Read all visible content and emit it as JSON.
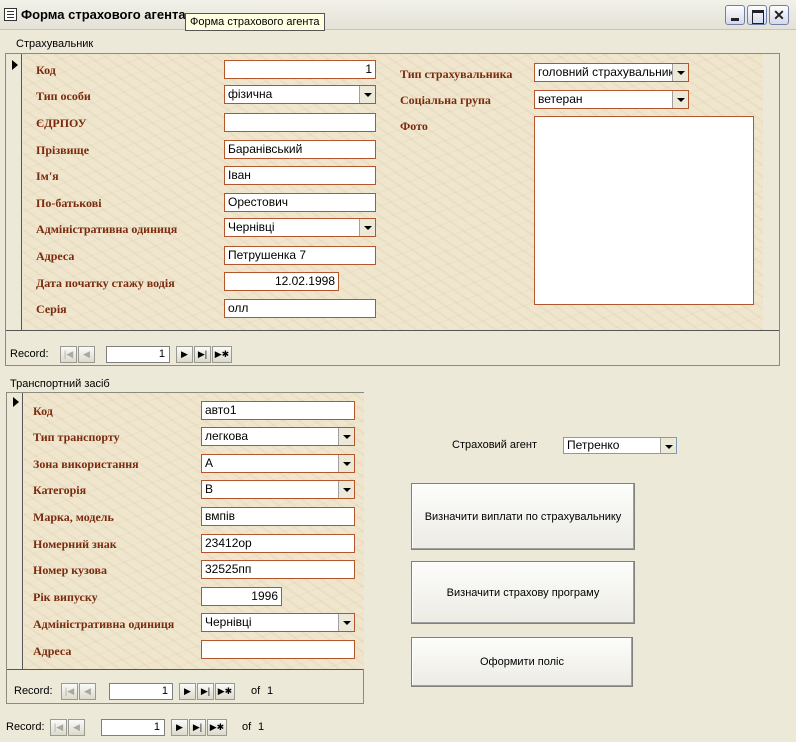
{
  "window": {
    "title": "Форма страхового агента",
    "tooltip": "Форма страхового агента",
    "minimize_icon": "minimize-icon",
    "maximize_icon": "maximize-icon",
    "close_icon": "close-icon",
    "close_glyph": "✕"
  },
  "insured": {
    "section_label": "Страхувальник",
    "fields": {
      "code": {
        "label": "Код",
        "value": "1"
      },
      "person_type": {
        "label": "Тип особи",
        "value": "фізична"
      },
      "edrpou": {
        "label": "ЄДРПОУ",
        "value": ""
      },
      "surname": {
        "label": "Прізвище",
        "value": "Баранівський"
      },
      "name": {
        "label": "Ім'я",
        "value": "Іван"
      },
      "patronymic": {
        "label": "По-батькові",
        "value": "Орестович"
      },
      "admin_unit": {
        "label": "Адміністративна одиниця",
        "value": "Чернівці"
      },
      "address": {
        "label": "Адреса",
        "value": "Петрушенка 7"
      },
      "driving_start": {
        "label": "Дата початку стажу водія",
        "value": "12.02.1998"
      },
      "series": {
        "label": "Серія",
        "value": "олл"
      },
      "insured_type": {
        "label": "Тип страхувальника",
        "value": "головний страхувальник"
      },
      "social_group": {
        "label": "Соціальна група",
        "value": "ветеран"
      },
      "photo": {
        "label": "Фото"
      }
    },
    "nav": {
      "label": "Record:",
      "current": "1",
      "of_text": "",
      "total": ""
    }
  },
  "vehicle": {
    "section_label": "Транспортний засіб",
    "fields": {
      "code": {
        "label": "Код",
        "value": "авто1"
      },
      "transport_type": {
        "label": "Тип транспорту",
        "value": "легкова"
      },
      "usage_zone": {
        "label": "Зона використання",
        "value": "А"
      },
      "category": {
        "label": "Категорія",
        "value": "В"
      },
      "make_model": {
        "label": "Марка, модель",
        "value": "вмпів"
      },
      "plate": {
        "label": "Номерний знак",
        "value": "23412ор"
      },
      "body_number": {
        "label": "Номер кузова",
        "value": "32525пп"
      },
      "year": {
        "label": "Рік випуску",
        "value": "1996"
      },
      "admin_unit": {
        "label": "Адміністративна одиниця",
        "value": "Чернівці"
      },
      "address": {
        "label": "Адреса",
        "value": ""
      }
    },
    "nav": {
      "label": "Record:",
      "current": "1",
      "of_text": "of",
      "total": "1"
    }
  },
  "agent": {
    "label": "Страховий агент",
    "value": "Петренко"
  },
  "buttons": {
    "payouts": "Визначити виплати по страхувальнику",
    "program": "Визначити страхову програму",
    "policy": "Оформити поліс"
  },
  "main_nav": {
    "label": "Record:",
    "current": "1",
    "of_text": "of",
    "total": "1"
  },
  "nav_glyphs": {
    "first": "|◀",
    "prev": "◀",
    "next": "▶",
    "last": "▶|",
    "new": "▶✱"
  }
}
